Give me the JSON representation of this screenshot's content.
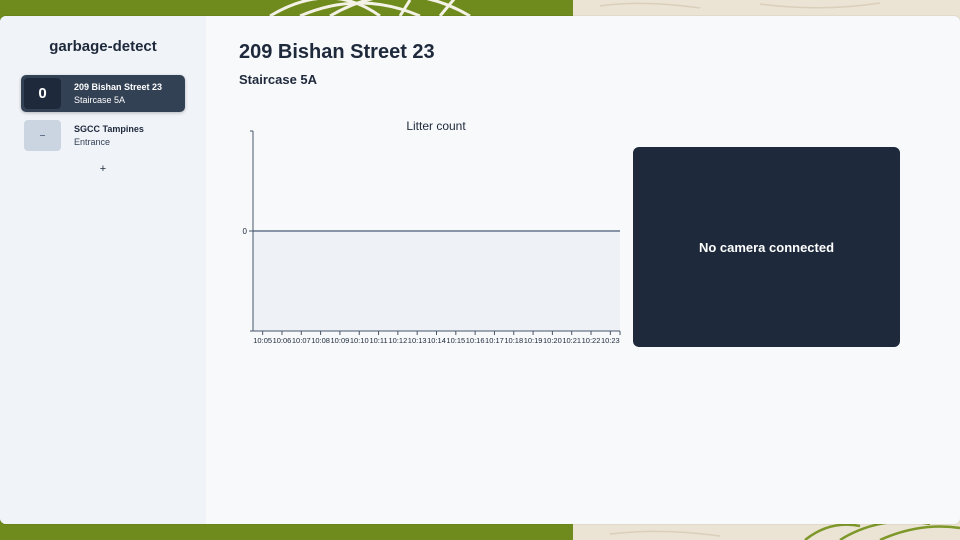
{
  "app": {
    "title": "garbage-detect"
  },
  "sidebar": {
    "locations": [
      {
        "badge": "0",
        "name": "209 Bishan Street 23",
        "sub": "Staircase 5A",
        "active": true
      },
      {
        "badge": "–",
        "name": "SGCC Tampines",
        "sub": "Entrance",
        "active": false
      }
    ],
    "add_label": "+"
  },
  "header": {
    "title": "209 Bishan Street 23",
    "subtitle": "Staircase 5A"
  },
  "camera": {
    "status": "No camera connected"
  },
  "colors": {
    "sidebar_bg": "#f0f3f8",
    "active_item": "#334155",
    "dark": "#1e293b",
    "chart_line": "#64748b",
    "chart_fill": "#eef2f7"
  },
  "chart_data": {
    "type": "area",
    "title": "Litter count",
    "x": [
      "10:05",
      "10:06",
      "10:07",
      "10:08",
      "10:09",
      "10:10",
      "10:11",
      "10:12",
      "10:13",
      "10:14",
      "10:15",
      "10:16",
      "10:17",
      "10:18",
      "10:19",
      "10:20",
      "10:21",
      "10:22",
      "10:23"
    ],
    "series": [
      {
        "values": [
          0,
          0,
          0,
          0,
          0,
          0,
          0,
          0,
          0,
          0,
          0,
          0,
          0,
          0,
          0,
          0,
          0,
          0,
          0
        ]
      }
    ],
    "yticks": [
      "0"
    ],
    "ylim": [
      -1,
      1
    ],
    "xlabel": "",
    "ylabel": "",
    "grid": false
  }
}
